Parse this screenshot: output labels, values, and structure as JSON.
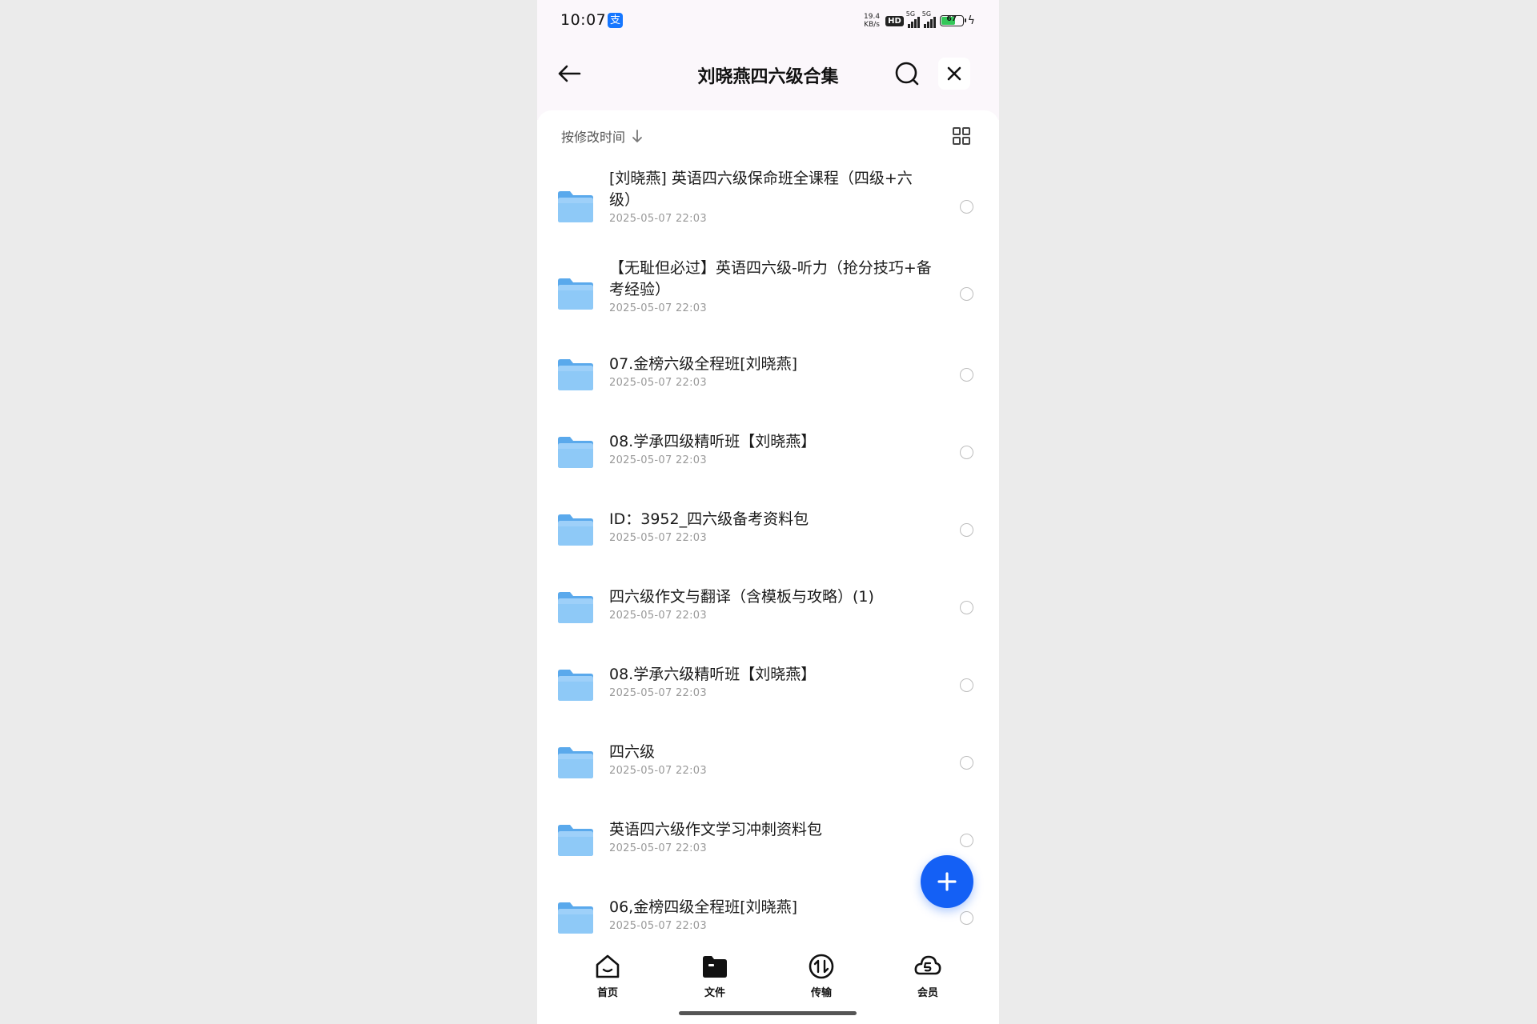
{
  "status_bar": {
    "time": "10:07",
    "app_badge": "支",
    "net_speed_value": "19.4",
    "net_speed_unit": "KB/s",
    "hd_label": "HD",
    "signal1_label": "5G",
    "signal2_label": "5G",
    "battery_level": "67"
  },
  "header": {
    "title": "刘晓燕四六级合集"
  },
  "sort": {
    "label": "按修改时间"
  },
  "files": [
    {
      "name": "[刘晓燕] 英语四六级保命班全课程（四级+六级）",
      "date": "2025-05-07 22:03"
    },
    {
      "name": "【无耻但必过】英语四六级-听力（抢分技巧+备考经验）",
      "date": "2025-05-07 22:03"
    },
    {
      "name": "07.金榜六级全程班[刘晓燕]",
      "date": "2025-05-07 22:03"
    },
    {
      "name": "08.学承四级精听班【刘晓燕】",
      "date": "2025-05-07 22:03"
    },
    {
      "name": "ID：3952_四六级备考资料包",
      "date": "2025-05-07 22:03"
    },
    {
      "name": "四六级作文与翻译（含模板与攻略）(1)",
      "date": "2025-05-07 22:03"
    },
    {
      "name": "08.学承六级精听班【刘晓燕】",
      "date": "2025-05-07 22:03"
    },
    {
      "name": "四六级",
      "date": "2025-05-07 22:03"
    },
    {
      "name": "英语四六级作文学习冲刺资料包",
      "date": "2025-05-07 22:03"
    },
    {
      "name": "06,金榜四级全程班[刘晓燕]",
      "date": "2025-05-07 22:03"
    }
  ],
  "bottom_nav": {
    "tabs": [
      {
        "label": "首页",
        "icon": "home-icon"
      },
      {
        "label": "文件",
        "icon": "folder-icon"
      },
      {
        "label": "传输",
        "icon": "transfer-icon"
      },
      {
        "label": "会员",
        "icon": "member-icon"
      }
    ],
    "active": "文件"
  },
  "colors": {
    "accent": "#1460f5",
    "folder": "#6ab4f0",
    "top_background": "#fbf7fb"
  }
}
